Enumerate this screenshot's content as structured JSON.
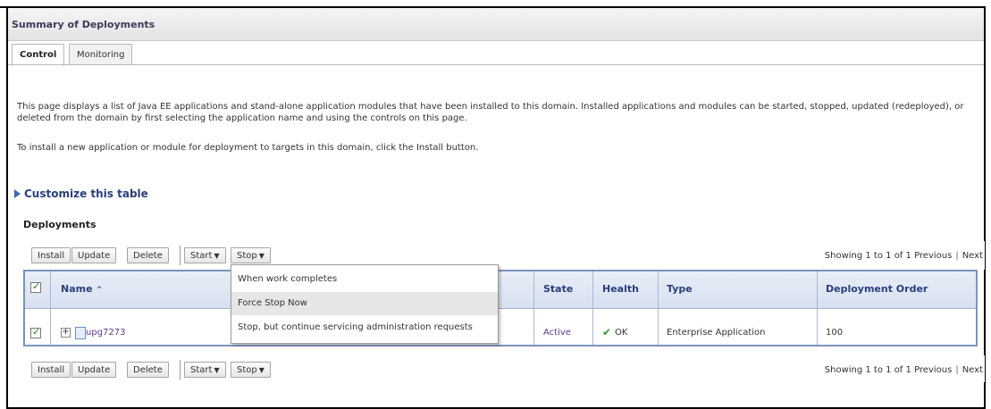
{
  "panel": {
    "title": "Summary of Deployments"
  },
  "tabs": [
    {
      "label": "Control"
    },
    {
      "label": "Monitoring"
    }
  ],
  "description": {
    "para1": "This page displays a list of Java EE applications and stand-alone application modules that have been installed to this domain. Installed applications and modules can be started, stopped, updated (redeployed), or deleted from the domain by first selecting the application name and using the controls on this page.",
    "para2": "To install a new application or module for deployment to targets in this domain, click the Install button."
  },
  "customize_link": "Customize this table",
  "section_title": "Deployments",
  "toolbar": {
    "install": "Install",
    "update": "Update",
    "delete": "Delete",
    "start": "Start",
    "stop": "Stop",
    "paging": "Showing 1 to 1 of 1",
    "previous": "Previous",
    "next": "Next"
  },
  "stop_menu": [
    {
      "label": "When work completes"
    },
    {
      "label": "Force Stop Now"
    },
    {
      "label": "Stop, but continue servicing administration requests"
    }
  ],
  "table": {
    "headers": {
      "name": "Name",
      "state": "State",
      "health": "Health",
      "type": "Type",
      "order": "Deployment Order"
    },
    "rows": [
      {
        "name": "upg7273",
        "state": "Active",
        "health": "OK",
        "type": "Enterprise Application",
        "order": "100"
      }
    ]
  },
  "colors": {
    "header_text": "#2a3f7a",
    "table_border": "#7d93be",
    "ok_green": "#3a9a2a"
  }
}
